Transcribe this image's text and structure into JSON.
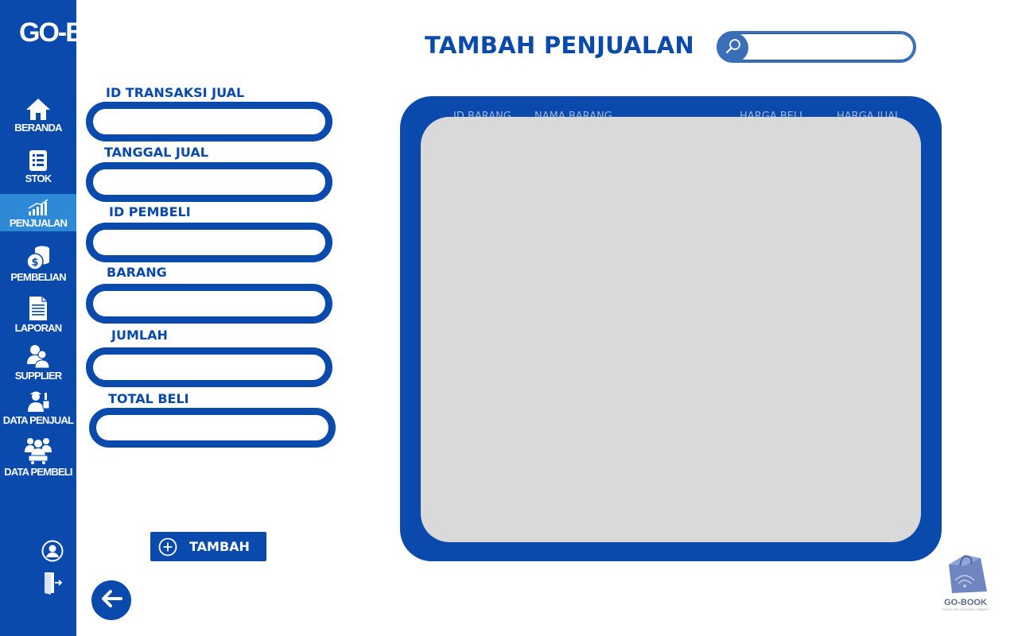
{
  "app": {
    "logo": "GO-BOOK"
  },
  "sidebar": {
    "items": [
      {
        "label": "BERANDA",
        "icon": "home-icon"
      },
      {
        "label": "STOK",
        "icon": "list-icon"
      },
      {
        "label": "PENJUALAN",
        "icon": "chart-icon",
        "active": true
      },
      {
        "label": "PEMBELIAN",
        "icon": "coins-icon"
      },
      {
        "label": "LAPORAN",
        "icon": "document-icon"
      },
      {
        "label": "SUPPLIER",
        "icon": "users-icon"
      },
      {
        "label": "DATA PENJUAL",
        "icon": "seller-icon"
      },
      {
        "label": "DATA PEMBELI",
        "icon": "buyers-icon"
      }
    ],
    "bottom_icons": [
      "user-circle-icon",
      "logout-icon"
    ]
  },
  "header": {
    "title": "TAMBAH PENJUALAN",
    "search": {
      "placeholder": "",
      "value": ""
    }
  },
  "form": {
    "fields": [
      {
        "label": "ID TRANSAKSI JUAL",
        "value": ""
      },
      {
        "label": "TANGGAL JUAL",
        "value": ""
      },
      {
        "label": "ID PEMBELI",
        "value": ""
      },
      {
        "label": "BARANG",
        "value": ""
      },
      {
        "label": "JUMLAH",
        "value": ""
      },
      {
        "label": "TOTAL BELI",
        "value": ""
      }
    ],
    "submit_label": "TAMBAH"
  },
  "table": {
    "columns": [
      "ID BARANG",
      "NAMA BARANG",
      "HARGA BELI",
      "HARGA JUAL"
    ],
    "rows": []
  },
  "corner_logo": {
    "brand": "GO-BOOK",
    "tagline": "TOKO KELONTONG SMART"
  },
  "colors": {
    "primary": "#0a4aad",
    "active": "#2e8ad6",
    "table_bg": "#d9d9d9",
    "search_accent": "#3a6fb8"
  }
}
